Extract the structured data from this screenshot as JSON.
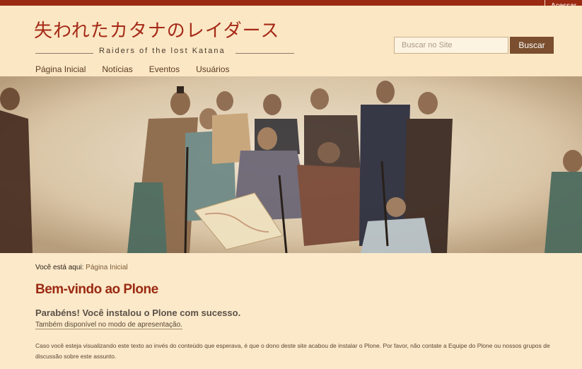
{
  "top_bar": {
    "login_label": "Acessar"
  },
  "header": {
    "logo_jp": "失われたカタナのレイダース",
    "logo_en": "Raiders of the lost Katana"
  },
  "search": {
    "placeholder": "Buscar no Site",
    "button_label": "Buscar"
  },
  "nav": {
    "items": [
      "Página Inicial",
      "Notícias",
      "Eventos",
      "Usuários"
    ]
  },
  "colors": {
    "accent": "#9b2a12",
    "background": "#fbe9c9",
    "button": "#7a4e2e"
  },
  "breadcrumb": {
    "prefix": "Você está aqui:",
    "current": "Página Inicial"
  },
  "content": {
    "title": "Bem-vindo ao Plone",
    "subtitle": "Parabéns! Você instalou o Plone com sucesso.",
    "presentation_link": "Também disponível no modo de apresentação.",
    "body": "Caso você esteja visualizando este texto ao invés do conteúdo que esperava, é que o dono deste site acabou de instalar o Plone. Por favor, não contate a Equipe do Plone ou nossos grupos de discussão sobre este assunto."
  }
}
